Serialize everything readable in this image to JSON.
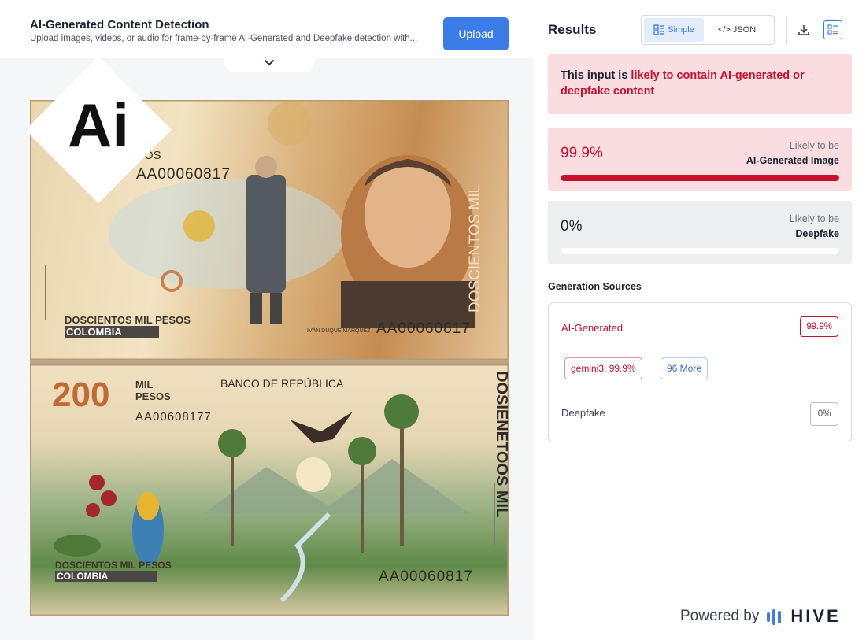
{
  "header": {
    "title": "AI-Generated Content Detection",
    "subtitle": "Upload images, videos, or audio for frame-by-frame AI-Generated and Deepfake detection with...",
    "upload_label": "Upload"
  },
  "banknote": {
    "top": {
      "series": "AA00060817",
      "side_text": "DOSCIENTOS MIL",
      "denomination_text": "DOSCIENTOS MIL PESOS",
      "country": "COLOMBIA",
      "portrait_caption": "IVÁN DUQUE MÁRQUEZ",
      "serial_bottom": "AA00060817",
      "partial_pesos": "SOS"
    },
    "bottom": {
      "value": "200",
      "mil": "MIL",
      "pesos": "PESOS",
      "series": "AA00608177",
      "bank": "BANCO DE REPÚBLICA",
      "side_text": "DOSIENETOOS MIL",
      "denomination_text": "DOSCIENTOS MIL PESOS",
      "country": "COLOMBIA",
      "serial_bottom": "AA00060817"
    },
    "badge_text": "Ai"
  },
  "results": {
    "title": "Results",
    "view_simple": "Simple",
    "view_json": "</> JSON",
    "alert_prefix": "This input is ",
    "alert_highlight": "likely to contain AI-generated or deepfake content",
    "ai_score": {
      "value": "99.9%",
      "fraction": 0.999,
      "caption_top": "Likely to be",
      "caption_bottom": "AI-Generated Image"
    },
    "deepfake_score": {
      "value": "0%",
      "fraction": 0,
      "caption_top": "Likely to be",
      "caption_bottom": "Deepfake"
    },
    "sources_title": "Generation Sources",
    "sources": {
      "ai_label": "AI-Generated",
      "ai_pct": "99.9%",
      "model_chip": "gemini3: 99.9%",
      "more_chip": "96 More",
      "deepfake_label": "Deepfake",
      "deepfake_pct": "0%"
    },
    "powered_by": "Powered by",
    "brand": "HIVE"
  },
  "colors": {
    "accent": "#3b7ce8",
    "danger": "#c8102e",
    "alert_bg": "#fadde0"
  }
}
